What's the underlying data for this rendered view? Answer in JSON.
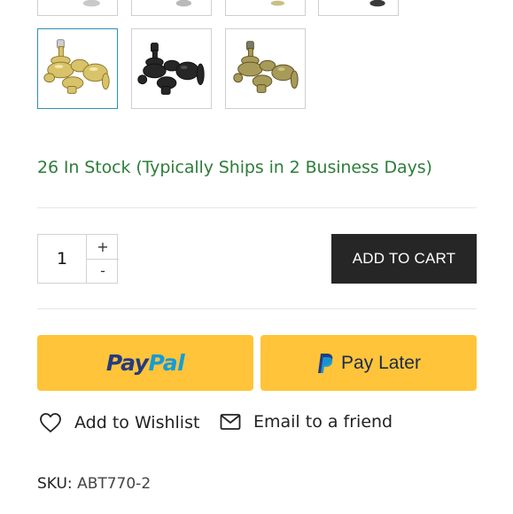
{
  "gallery": {
    "top_row_count": 4,
    "bottom_row": [
      {
        "finish": "polished brass",
        "selected": true
      },
      {
        "finish": "matte black",
        "selected": false
      },
      {
        "finish": "antique brass",
        "selected": false
      }
    ]
  },
  "stock": {
    "text": "26 In Stock (Typically Ships in 2 Business Days)",
    "color": "#2e7d3a"
  },
  "quantity": {
    "value": "1",
    "increment_label": "+",
    "decrement_label": "-"
  },
  "cart": {
    "add_to_cart_label": "ADD TO CART"
  },
  "payment": {
    "paypal_part1": "Pay",
    "paypal_part2": "Pal",
    "pay_later_label": "Pay Later",
    "button_color": "#ffc439"
  },
  "actions": {
    "wishlist_label": "Add to Wishlist",
    "wishlist_icon": "heart-icon",
    "email_label": "Email to a friend",
    "email_icon": "envelope-icon"
  },
  "sku": {
    "label": "SKU:",
    "value": "ABT770-2"
  }
}
